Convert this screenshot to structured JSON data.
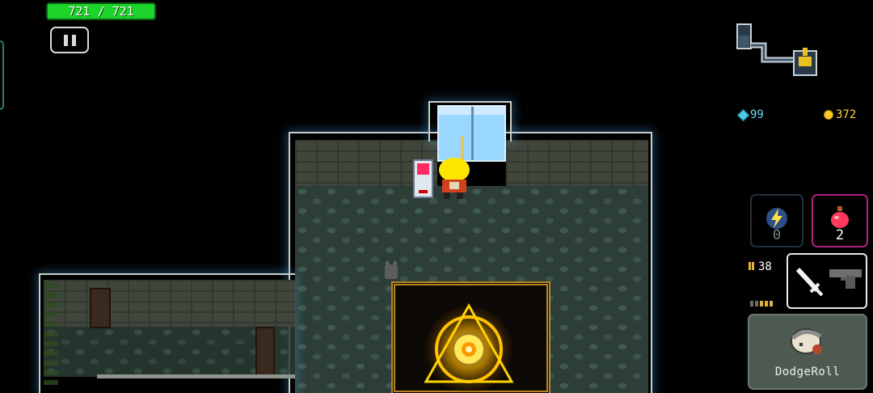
{
  "hud": {
    "hp_text": "721 / 721",
    "hp_fraction": 1.0,
    "gems": "99",
    "coins": "372",
    "skill_count": "0",
    "potion_count": "2",
    "ammo_count": "38",
    "dodge_label": "DodgeRoll"
  },
  "icons": {
    "pause": "pause-icon",
    "skill": "lightning-icon",
    "potion": "health-potion-icon",
    "primary_weapon": "sword-icon",
    "secondary_weapon": "pistol-icon",
    "dodge": "dodge-roll-icon",
    "gem": "gem-icon",
    "coin": "coin-icon"
  },
  "colors": {
    "hp_bar": "#1dd42a",
    "potion_border": "#b0227a",
    "portal_glow": "#ffb400",
    "gem": "#6ad7f0",
    "coin": "#ffd23a"
  }
}
